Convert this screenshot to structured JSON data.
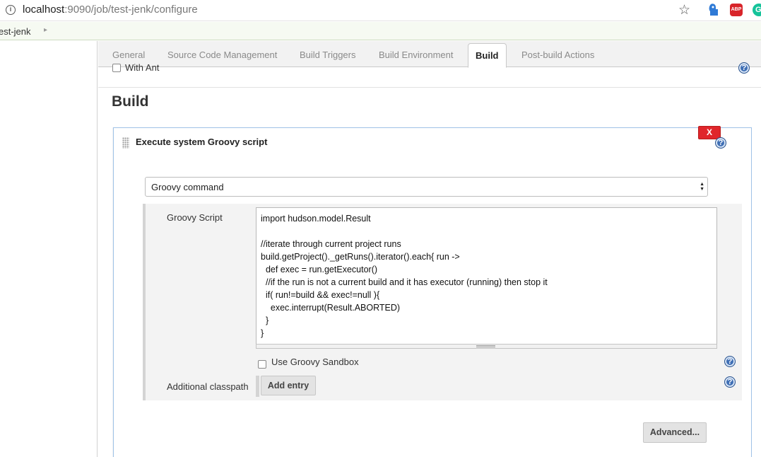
{
  "browser": {
    "url_host": "localhost",
    "url_rest": ":9090/job/test-jenk/configure"
  },
  "breadcrumb": {
    "item": "est-jenk"
  },
  "tabs": [
    {
      "label": "General"
    },
    {
      "label": "Source Code Management"
    },
    {
      "label": "Build Triggers"
    },
    {
      "label": "Build Environment"
    },
    {
      "label": "Build"
    },
    {
      "label": "Post-build Actions"
    }
  ],
  "active_tab": "Build",
  "previous_option": "With Ant",
  "section": {
    "title": "Build"
  },
  "step": {
    "title": "Execute system Groovy script",
    "delete_label": "X",
    "select_value": "Groovy command",
    "script_label": "Groovy Script",
    "script_lines": [
      "import hudson.model.Result",
      "",
      "//iterate through current project runs",
      "build.getProject()._getRuns().iterator().each{ run ->",
      "  def exec = run.getExecutor()",
      "  //if the run is not a current build and it has executor (running) then stop it",
      "  if( run!=build && exec!=null ){",
      "    exec.interrupt(Result.ABORTED)",
      "  }",
      "}"
    ],
    "sandbox_label": "Use Groovy Sandbox",
    "classpath_label": "Additional classpath",
    "add_entry_label": "Add entry",
    "advanced_label": "Advanced..."
  },
  "icons": {
    "help": "help-icon",
    "star": "star-icon",
    "info": "info-icon"
  },
  "colors": {
    "delete_red": "#e0262b",
    "help_blue": "#3f6fb5",
    "step_border": "#9fc2e7"
  }
}
